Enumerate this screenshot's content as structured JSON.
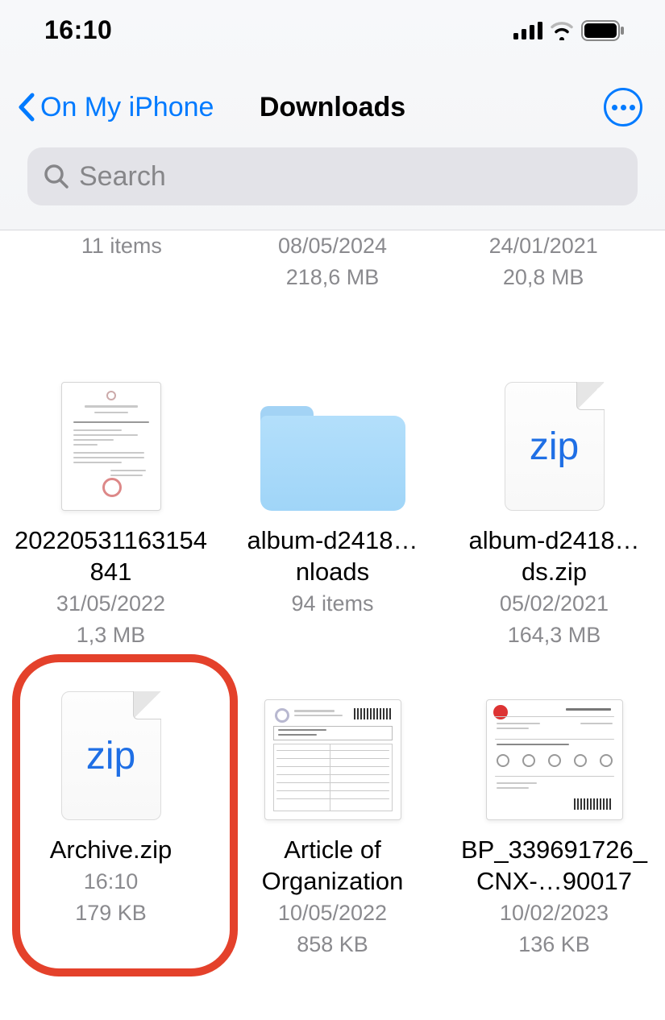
{
  "status": {
    "time": "16:10"
  },
  "nav": {
    "back_label": "On My iPhone",
    "title": "Downloads"
  },
  "search": {
    "placeholder": "Search"
  },
  "partial_row": [
    {
      "line1": "11 items",
      "line2": ""
    },
    {
      "line1": "08/05/2024",
      "line2": "218,6 MB"
    },
    {
      "line1": "24/01/2021",
      "line2": "20,8 MB"
    }
  ],
  "files": [
    {
      "name": "2022053116315484​1",
      "date": "31/05/2022",
      "size": "1,3 MB",
      "icon": "doc-narrow"
    },
    {
      "name": "album-d2418…nloads",
      "date": "94 items",
      "size": "",
      "icon": "folder"
    },
    {
      "name": "album-d2418…ds.zip",
      "date": "05/02/2021",
      "size": "164,3 MB",
      "icon": "zip"
    },
    {
      "name": "Archive.zip",
      "date": "16:10",
      "size": "179 KB",
      "icon": "zip",
      "highlighted": true
    },
    {
      "name": "Article of Organization",
      "date": "10/05/2022",
      "size": "858 KB",
      "icon": "doc-wide"
    },
    {
      "name": "BP_339691726_CNX-…90017",
      "date": "10/02/2023",
      "size": "136 KB",
      "icon": "doc-wide"
    }
  ],
  "icons": {
    "zip_label": "zip"
  }
}
